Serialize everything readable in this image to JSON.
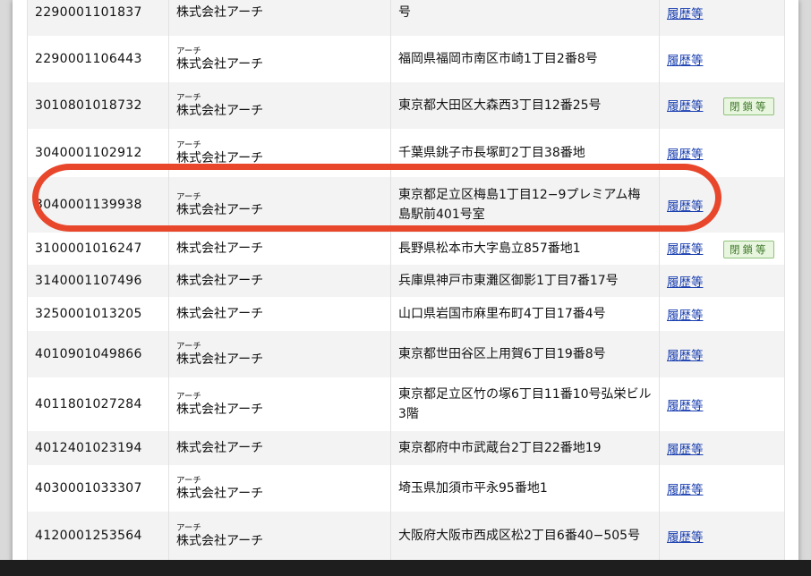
{
  "table": {
    "rows": [
      {
        "number": "2290001101837",
        "kana": "",
        "name": "株式会社アーチ",
        "address": "号",
        "link": "履歴等",
        "badge": ""
      },
      {
        "number": "2290001106443",
        "kana": "アーチ",
        "name": "株式会社アーチ",
        "address": "福岡県福岡市南区市崎1丁目2番8号",
        "link": "履歴等",
        "badge": ""
      },
      {
        "number": "3010801018732",
        "kana": "アーチ",
        "name": "株式会社アーチ",
        "address": "東京都大田区大森西3丁目12番25号",
        "link": "履歴等",
        "badge": "閉鎖等"
      },
      {
        "number": "3040001102912",
        "kana": "アーチ",
        "name": "株式会社アーチ",
        "address": "千葉県銚子市長塚町2丁目38番地",
        "link": "履歴等",
        "badge": ""
      },
      {
        "number": "3040001139938",
        "kana": "アーチ",
        "name": "株式会社アーチ",
        "address": "東京都足立区梅島1丁目12−9プレミアム梅島駅前401号室",
        "link": "履歴等",
        "badge": ""
      },
      {
        "number": "3100001016247",
        "kana": "",
        "name": "株式会社アーチ",
        "address": "長野県松本市大字島立857番地1",
        "link": "履歴等",
        "badge": "閉鎖等"
      },
      {
        "number": "3140001107496",
        "kana": "",
        "name": "株式会社アーチ",
        "address": "兵庫県神戸市東灘区御影1丁目7番17号",
        "link": "履歴等",
        "badge": ""
      },
      {
        "number": "3250001013205",
        "kana": "",
        "name": "株式会社アーチ",
        "address": "山口県岩国市麻里布町4丁目17番4号",
        "link": "履歴等",
        "badge": ""
      },
      {
        "number": "4010901049866",
        "kana": "アーチ",
        "name": "株式会社アーチ",
        "address": "東京都世田谷区上用賀6丁目19番8号",
        "link": "履歴等",
        "badge": ""
      },
      {
        "number": "4011801027284",
        "kana": "アーチ",
        "name": "株式会社アーチ",
        "address": "東京都足立区竹の塚6丁目11番10号弘栄ビル3階",
        "link": "履歴等",
        "badge": ""
      },
      {
        "number": "4012401023194",
        "kana": "",
        "name": "株式会社アーチ",
        "address": "東京都府中市武蔵台2丁目22番地19",
        "link": "履歴等",
        "badge": ""
      },
      {
        "number": "4030001033307",
        "kana": "アーチ",
        "name": "株式会社アーチ",
        "address": "埼玉県加須市平永95番地1",
        "link": "履歴等",
        "badge": ""
      },
      {
        "number": "4120001253564",
        "kana": "アーチ",
        "name": "株式会社アーチ",
        "address": "大阪府大阪市西成区松2丁目6番40−505号",
        "link": "履歴等",
        "badge": ""
      }
    ]
  },
  "colors": {
    "link": "#1a3fb0",
    "highlight_circle": "#e8472c",
    "badge_border": "#8fc27a",
    "badge_background": "#e9f6df"
  }
}
